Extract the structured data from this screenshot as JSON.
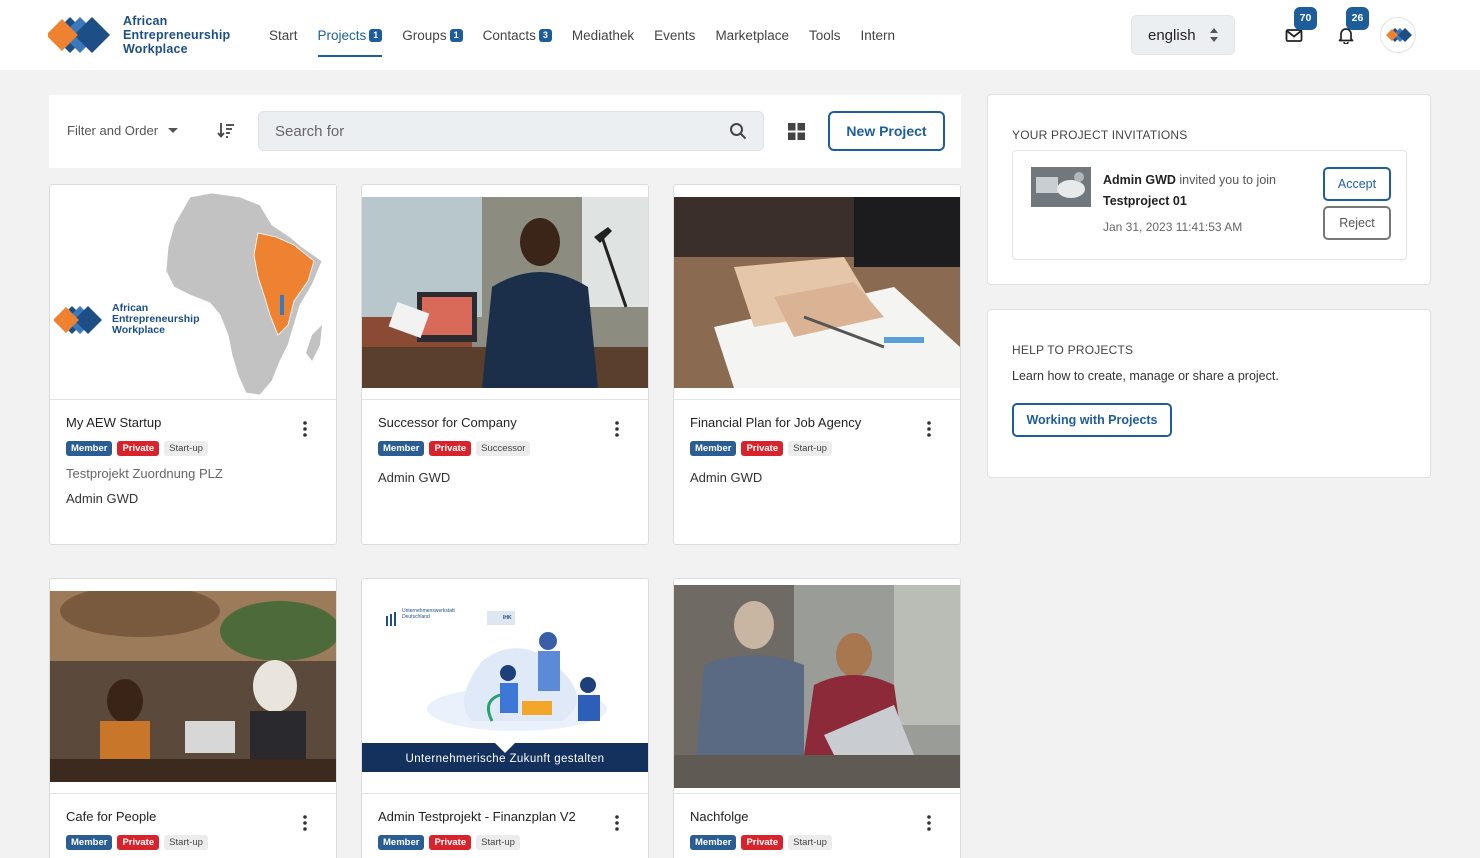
{
  "brand": {
    "line1": "African",
    "line2": "Entrepreneurship",
    "line3": "Workplace"
  },
  "nav": [
    {
      "label": "Start",
      "badge": ""
    },
    {
      "label": "Projects",
      "badge": "1"
    },
    {
      "label": "Groups",
      "badge": "1"
    },
    {
      "label": "Contacts",
      "badge": "3"
    },
    {
      "label": "Mediathek",
      "badge": ""
    },
    {
      "label": "Events",
      "badge": ""
    },
    {
      "label": "Marketplace",
      "badge": ""
    },
    {
      "label": "Tools",
      "badge": ""
    },
    {
      "label": "Intern",
      "badge": ""
    }
  ],
  "header": {
    "language": "english",
    "mail_count": "70",
    "notification_count": "26"
  },
  "toolbar": {
    "filter_label": "Filter and Order",
    "search_placeholder": "Search for",
    "new_project_label": "New Project"
  },
  "cards": [
    {
      "title": "My AEW Startup",
      "tags": [
        "Member",
        "Private",
        "Start-up"
      ],
      "subtitle": "Testprojekt Zuordnung PLZ",
      "owner": "Admin GWD",
      "image_logo": {
        "line1": "African",
        "line2": "Entrepreneurship",
        "line3": "Workplace"
      }
    },
    {
      "title": "Successor for Company",
      "tags": [
        "Member",
        "Private",
        "Successor"
      ],
      "subtitle": "",
      "owner": "Admin GWD"
    },
    {
      "title": "Financial Plan for Job Agency",
      "tags": [
        "Member",
        "Private",
        "Start-up"
      ],
      "subtitle": "",
      "owner": "Admin GWD"
    },
    {
      "title": "Cafe for People",
      "tags": [
        "Member",
        "Private",
        "Start-up"
      ]
    },
    {
      "title": "Admin Testprojekt - Finanzplan V2",
      "tags": [
        "Member",
        "Private",
        "Start-up"
      ],
      "image_caption": "Unternehmerische Zukunft gestalten",
      "image_brand": "Unternehmenswerkstatt Deutschland",
      "image_badge": "IHK"
    },
    {
      "title": "Nachfolge",
      "tags": [
        "Member",
        "Private",
        "Start-up"
      ]
    }
  ],
  "invitations": {
    "title": "YOUR PROJECT INVITATIONS",
    "item": {
      "inviter": "Admin GWD",
      "text": "invited you to join",
      "project": "Testproject 01",
      "date": "Jan 31, 2023 11:41:53 AM",
      "accept_label": "Accept",
      "reject_label": "Reject"
    }
  },
  "help": {
    "title": "HELP TO PROJECTS",
    "text": "Learn how to create, manage or share a project.",
    "button_label": "Working with Projects"
  },
  "colors": {
    "accent": "#1d5e9a",
    "orange": "#ee8231",
    "private": "#d9232c",
    "member": "#2b5d95"
  }
}
